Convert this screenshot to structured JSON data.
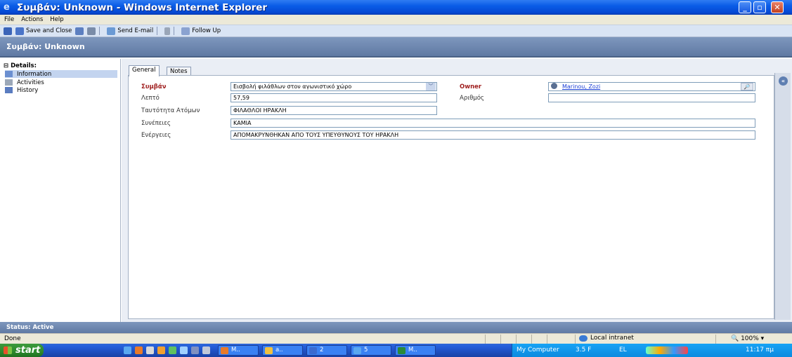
{
  "window": {
    "title": "Συμβάν: Unknown - Windows Internet Explorer",
    "minimize": "_",
    "maximize": "▫",
    "close": "✕"
  },
  "menu": [
    "File",
    "Actions",
    "Help"
  ],
  "toolbar": {
    "save_close": "Save and Close",
    "send_email": "Send E-mail",
    "follow_up": "Follow Up"
  },
  "header": {
    "title": "Συμβάν: Unknown"
  },
  "nav": {
    "details": "Details:",
    "items": [
      "Information",
      "Activities",
      "History"
    ]
  },
  "tabs": [
    "General",
    "Notes"
  ],
  "form": {
    "symvan_label": "Συμβάν",
    "symvan_value": "Εισβολή φιλάθλων στον αγωνιστικό χώρο",
    "lepto_label": "Λεπτό",
    "lepto_value": "57,59",
    "tautotita_label": "Ταυτότητα Ατόμων",
    "tautotita_value": "ΦΙΛΑΘΛΟΙ ΗΡΑΚΛΗ",
    "synepeies_label": "Συνέπειες",
    "synepeies_value": "ΚΑΜΙΑ",
    "energeies_label": "Ενέργειες",
    "energeies_value": "ΑΠΟΜΑΚΡΥΝΘΗΚΑΝ ΑΠΟ ΤΟΥΣ ΥΠΕΥΘΥΝΟΥΣ ΤΟΥ ΗΡΑΚΛΗ",
    "owner_label": "Owner",
    "owner_value": "Marinou, Zozi",
    "arithmos_label": "Αριθμός",
    "arithmos_value": ""
  },
  "form_status": "Status: Active",
  "ie_status": {
    "text": "Done",
    "zone": "Local intranet",
    "zoom": "100%"
  },
  "taskbar": {
    "start": "start",
    "tasks": [
      "M..",
      "a..",
      "2",
      "5",
      "M.."
    ],
    "tray": {
      "my_computer": "My Computer",
      "temp": "3.5 F",
      "lang": "EL",
      "time": "11:17 πμ"
    }
  },
  "colors": {
    "title_blue": "#0a5ce6",
    "header_blue": "#6f88b0",
    "required_red": "#a02020",
    "link_blue": "#1a3fd6"
  },
  "icons": [
    "ie-icon",
    "save-icon",
    "save-close-icon",
    "print-icon",
    "email-icon",
    "attach-icon",
    "follow-up-icon",
    "lookup-icon",
    "user-icon",
    "collapse-icon"
  ]
}
